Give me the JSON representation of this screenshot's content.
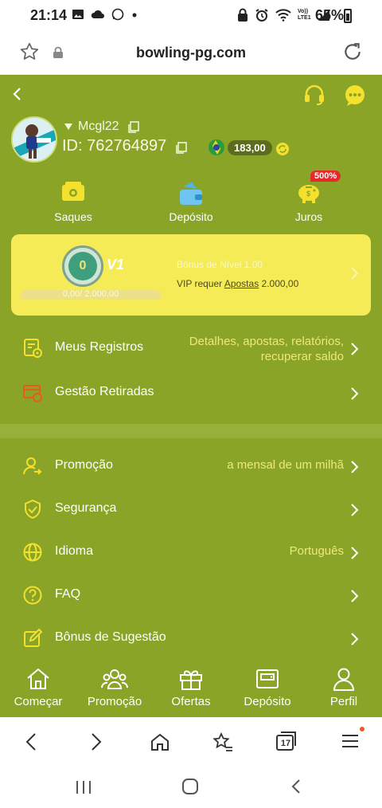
{
  "status_bar": {
    "time": "21:14",
    "battery": "65%",
    "volte": "Vo))\nLTE1"
  },
  "browser": {
    "url": "bowling-pg.com",
    "tabs_count": "17"
  },
  "profile": {
    "username": "Mcgl22",
    "id_text": "ID: 762764897",
    "balance": "183,00"
  },
  "quick_actions": [
    {
      "label": "Saques",
      "icon": "withdraw-icon"
    },
    {
      "label": "Depósito",
      "icon": "deposit-wallet-icon"
    },
    {
      "label": "Juros",
      "icon": "piggy-bank-icon",
      "badge": "500%"
    }
  ],
  "vip": {
    "coin_level": "0",
    "level": "V1",
    "progress_text": "0,00/ 2.000,00",
    "progress_fraction": 0,
    "bonus_text": "Bônus de Nível 1,00",
    "requirement_prefix": "VIP requer",
    "requirement_link": "Apostas",
    "requirement_amount": "2.000,00"
  },
  "menu_group1": [
    {
      "label": "Meus Registros",
      "value_line1": "Detalhes, apostas, relatórios,",
      "value_line2": "recuperar saldo",
      "icon": "records-icon"
    },
    {
      "label": "Gestão Retiradas",
      "value_line1": "",
      "value_line2": "",
      "icon": "withdraw-management-icon"
    }
  ],
  "menu_group2": [
    {
      "label": "Promoção",
      "value": "a mensal de um milhã",
      "icon": "promotion-user-icon"
    },
    {
      "label": "Segurança",
      "value": "",
      "icon": "shield-icon"
    },
    {
      "label": "Idioma",
      "value": "Português",
      "icon": "globe-icon"
    },
    {
      "label": "FAQ",
      "value": "",
      "icon": "question-icon"
    },
    {
      "label": "Bônus de Sugestão",
      "value": "",
      "icon": "edit-icon"
    }
  ],
  "bottom_nav": [
    {
      "label": "Começar",
      "icon": "home-icon"
    },
    {
      "label": "Promoção",
      "icon": "group-icon"
    },
    {
      "label": "Ofertas",
      "icon": "gift-icon"
    },
    {
      "label": "Depósito",
      "icon": "wallet-icon"
    },
    {
      "label": "Perfil",
      "icon": "profile-icon"
    }
  ],
  "colors": {
    "app_bg": "#8aa428",
    "vip_card": "#f5eb56",
    "accent_yellow": "#efe77a",
    "badge_red": "#e8282b"
  }
}
